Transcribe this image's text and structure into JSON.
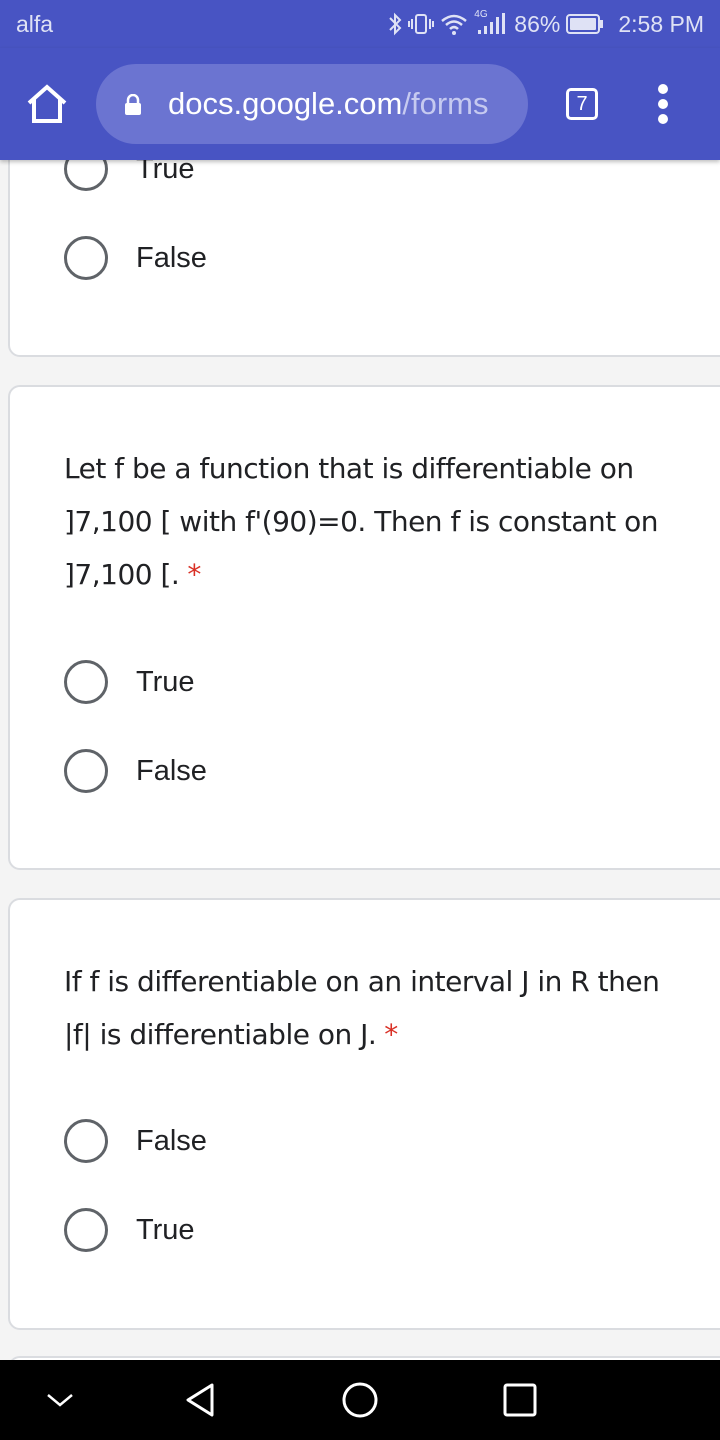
{
  "status_bar": {
    "carrier": "alfa",
    "network": "4G",
    "battery": "86%",
    "time": "2:58 PM"
  },
  "browser": {
    "url_domain": "docs.google.com",
    "url_path": "/forms",
    "tab_count": "7"
  },
  "form": {
    "partial_options": [
      "True",
      "False"
    ],
    "questions": [
      {
        "lines": [
          "Let f be a function that is differentiable on",
          "]7,100 [ with f'(90)=0. Then f is constant on",
          "]7,100 [."
        ],
        "required_marker": "*",
        "options": [
          "True",
          "False"
        ]
      },
      {
        "lines": [
          "If f is differentiable on an interval J in R then",
          "|f| is differentiable on J."
        ],
        "required_marker": "*",
        "options": [
          "False",
          "True"
        ]
      }
    ]
  },
  "colors": {
    "app_bar": "#4854c3",
    "url_bar": "#6b74d1",
    "required": "#d93025"
  }
}
